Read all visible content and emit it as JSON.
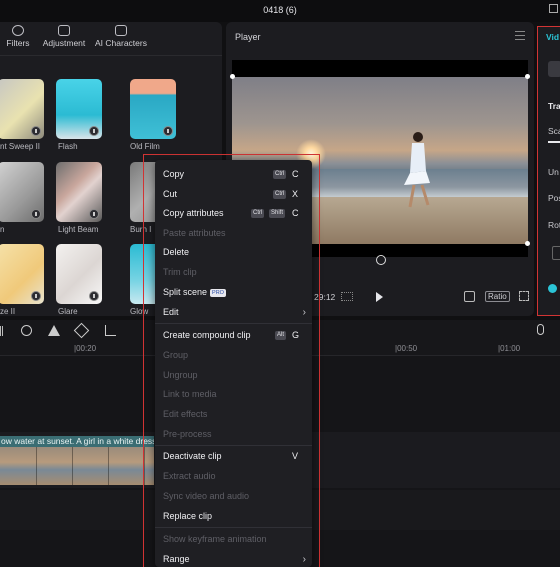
{
  "window": {
    "title": "0418 (6)"
  },
  "left_panel": {
    "tabs": [
      {
        "label": "Filters",
        "icon": "filters-icon"
      },
      {
        "label": "Adjustment",
        "icon": "adjustment-icon"
      },
      {
        "label": "AI Characters",
        "icon": "ai-characters-icon"
      }
    ],
    "effects": [
      {
        "label": "nt Sweep II"
      },
      {
        "label": "Flash"
      },
      {
        "label": "Old Film"
      },
      {
        "label": "n"
      },
      {
        "label": "Light Beam"
      },
      {
        "label": "Burn I"
      },
      {
        "label": "ze II"
      },
      {
        "label": "Glare"
      },
      {
        "label": "Glow"
      }
    ]
  },
  "player": {
    "title": "Player",
    "time": "29:12",
    "ratio_label": "Ratio"
  },
  "inspector": {
    "tab_label": "Vid",
    "section_label": "Tra",
    "items": [
      "Sca",
      "Un",
      "Pos",
      "Rot"
    ]
  },
  "timeline": {
    "ticks": [
      "|00:20",
      "|00:50",
      "|01:00"
    ],
    "clip_label": "ow water at sunset. A girl in a white dress"
  },
  "context_menu": {
    "items": [
      {
        "label": "Copy",
        "mod": "Ctrl",
        "key": "C",
        "enabled": true
      },
      {
        "label": "Cut",
        "mod": "Ctrl",
        "key": "X",
        "enabled": true
      },
      {
        "label": "Copy attributes",
        "mod": "Ctrl",
        "mod2": "Shift",
        "key": "C",
        "enabled": true
      },
      {
        "label": "Paste attributes",
        "enabled": false
      },
      {
        "label": "Delete",
        "enabled": true
      },
      {
        "label": "Trim clip",
        "enabled": false
      },
      {
        "label": "Split scene",
        "badge": "PRO",
        "enabled": true
      },
      {
        "label": "Edit",
        "submenu": true,
        "enabled": true
      },
      {
        "label": "Create compound clip",
        "mod": "Alt",
        "key": "G",
        "enabled": true
      },
      {
        "label": "Group",
        "enabled": false
      },
      {
        "label": "Ungroup",
        "enabled": false
      },
      {
        "label": "Link to media",
        "enabled": false
      },
      {
        "label": "Edit effects",
        "enabled": false
      },
      {
        "label": "Pre-process",
        "enabled": false
      },
      {
        "label": "Deactivate clip",
        "key": "V",
        "enabled": true
      },
      {
        "label": "Extract audio",
        "enabled": false
      },
      {
        "label": "Sync video and audio",
        "enabled": false
      },
      {
        "label": "Replace clip",
        "enabled": true
      },
      {
        "label": "Show keyframe animation",
        "enabled": false
      },
      {
        "label": "Range",
        "submenu": true,
        "enabled": true
      }
    ]
  },
  "colors": {
    "highlight": "#d23434",
    "accent": "#2bc4d6",
    "clip": "#3a6d73"
  }
}
